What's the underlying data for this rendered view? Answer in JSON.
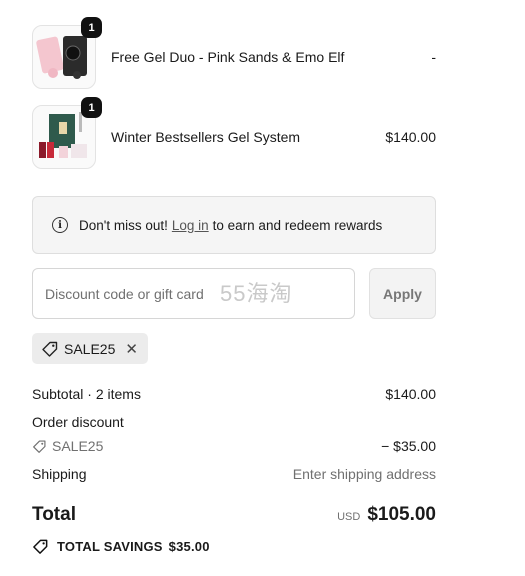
{
  "line_items": [
    {
      "title": "Free Gel Duo - Pink Sands & Emo Elf",
      "price": "-",
      "quantity": "1",
      "image": "gel-duo-product-photo"
    },
    {
      "title": "Winter Bestsellers Gel System",
      "price": "$140.00",
      "quantity": "1",
      "image": "gel-system-kit-photo"
    }
  ],
  "rewards": {
    "lead": "Don't miss out!",
    "link": "Log in",
    "rest": "to earn and redeem rewards",
    "icon": "info-icon"
  },
  "discount": {
    "placeholder": "Discount code or gift card",
    "apply_label": "Apply",
    "watermark": "55海淘",
    "applied_code": "SALE25"
  },
  "summary": {
    "subtotal_label": "Subtotal · 2 items",
    "subtotal_value": "$140.00",
    "order_discount_label": "Order discount",
    "discount_code": "SALE25",
    "discount_value": "− $35.00",
    "shipping_label": "Shipping",
    "shipping_value": "Enter shipping address",
    "total_label": "Total",
    "currency": "USD",
    "total_value": "$105.00",
    "savings_label": "TOTAL SAVINGS",
    "savings_value": "$35.00"
  }
}
